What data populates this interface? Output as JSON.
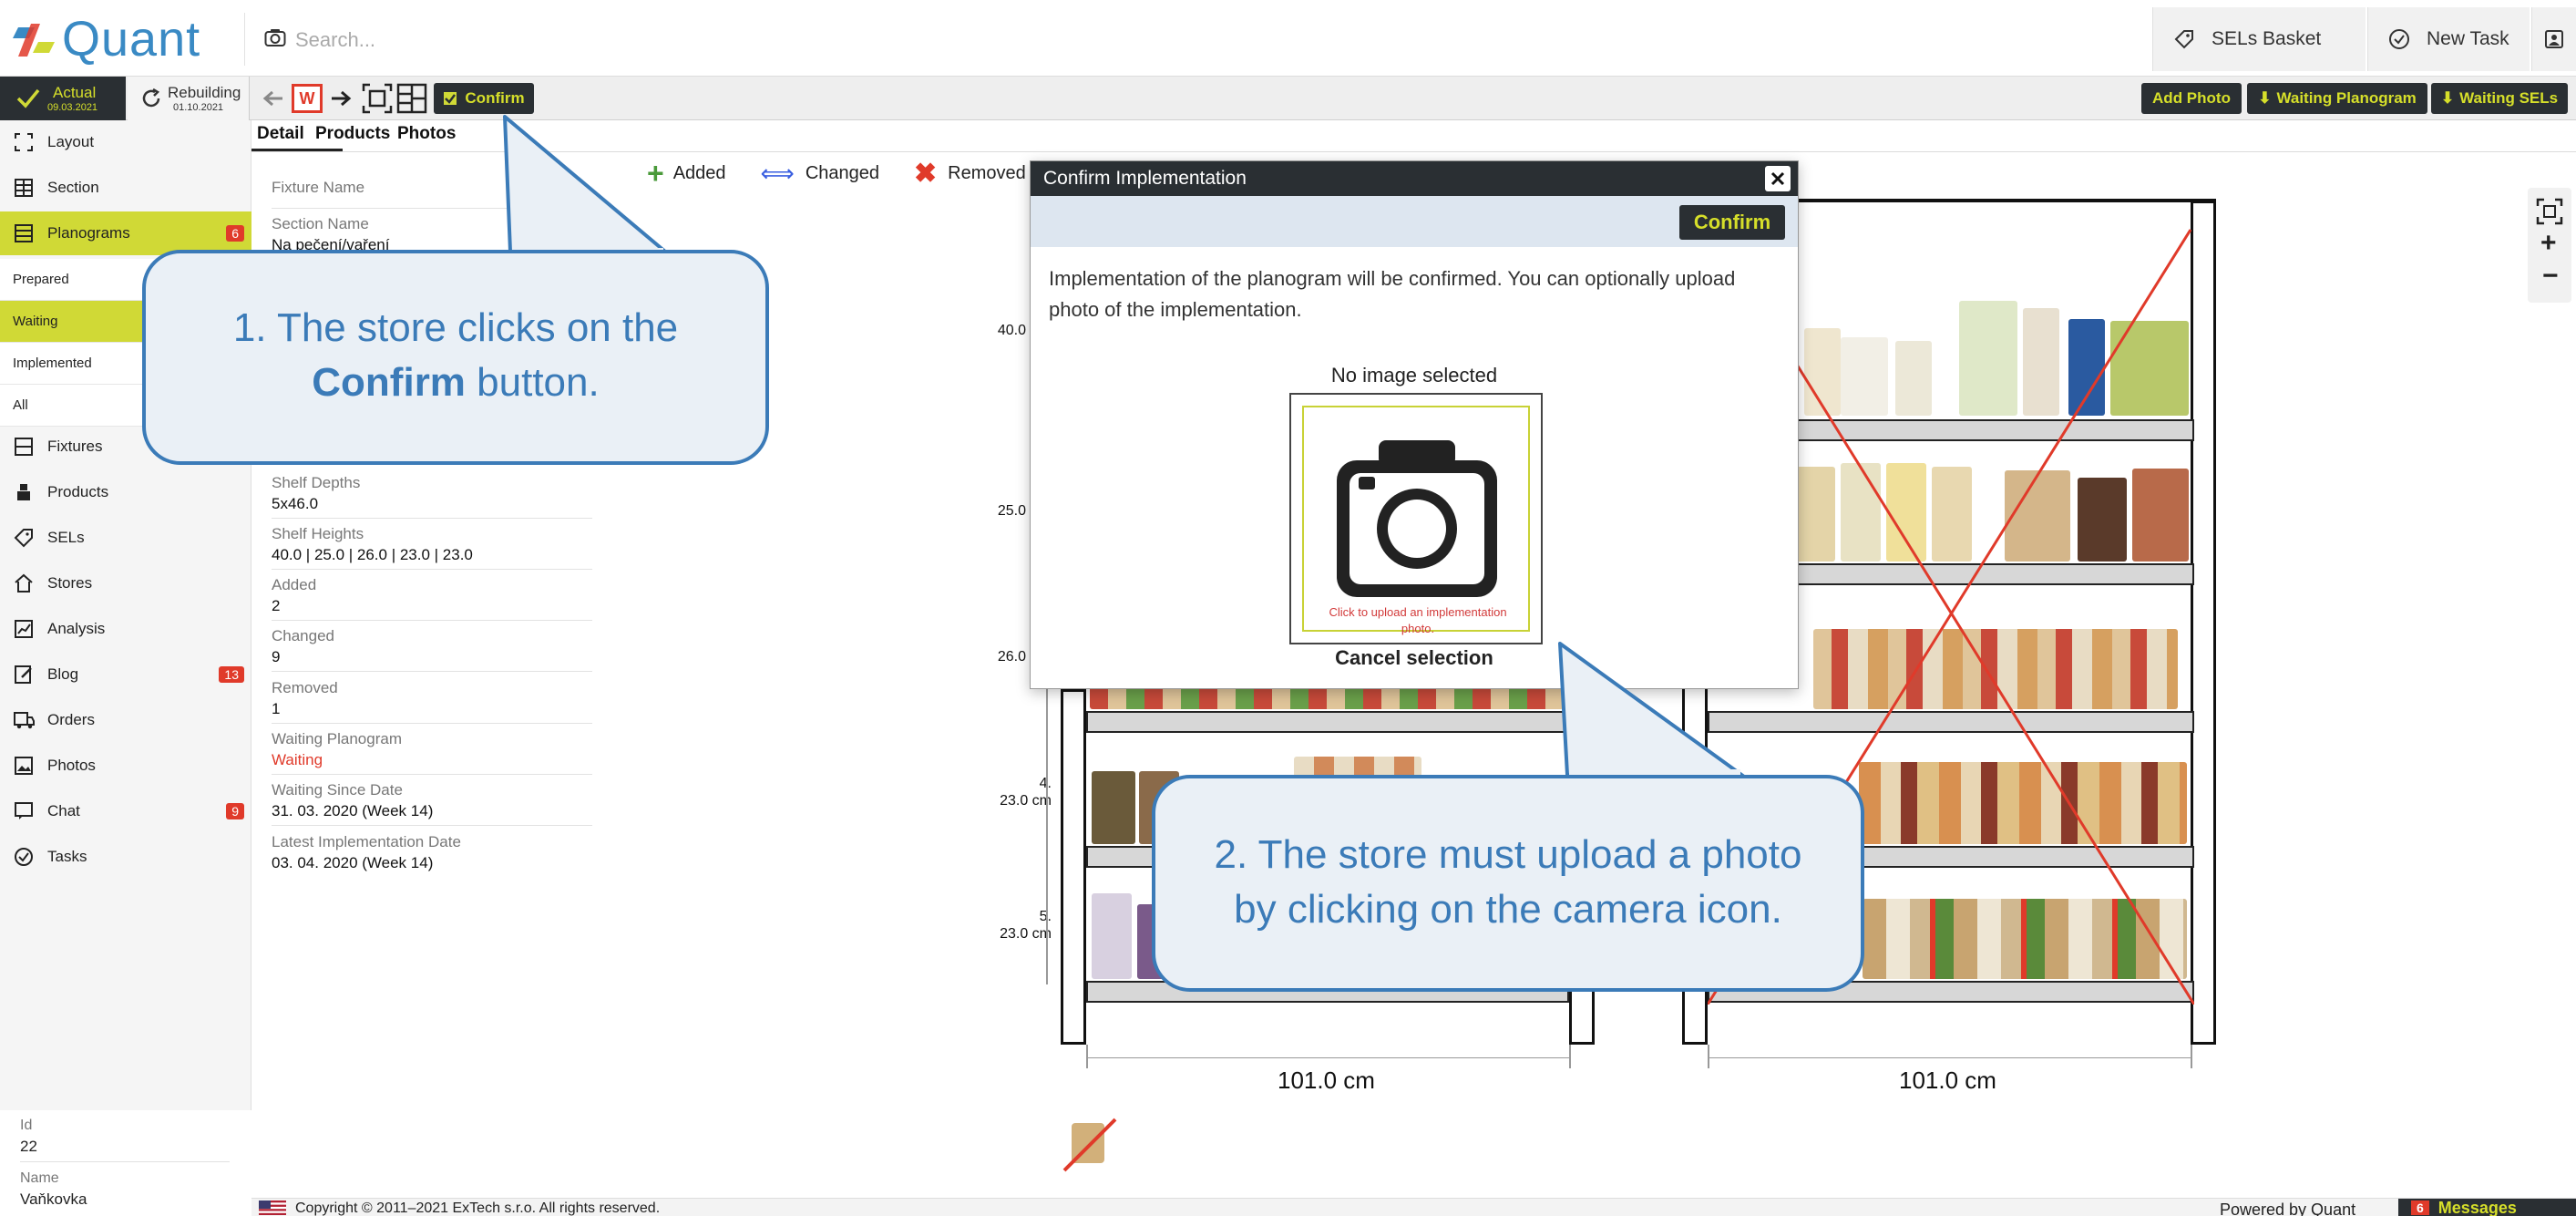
{
  "colors": {
    "accent": "#d0d936",
    "dark": "#2a2f33",
    "brand_blue": "#3a8ac4",
    "callout_blue": "#3b7bb8",
    "badge_red": "#e03a2a"
  },
  "header": {
    "logo_text": "Quant",
    "search_placeholder": "Search...",
    "sels_basket": "SELs Basket",
    "new_task": "New Task"
  },
  "toolbar": {
    "actual_label": "Actual",
    "actual_date": "09.03.2021",
    "rebuilding_label": "Rebuilding",
    "rebuilding_date": "01.10.2021",
    "w_label": "W",
    "confirm_label": "Confirm",
    "add_photo": "Add Photo",
    "waiting_planogram": "Waiting Planogram",
    "waiting_sels": "Waiting SELs"
  },
  "sidebar": {
    "items": [
      {
        "label": "Layout",
        "icon": "layout-icon"
      },
      {
        "label": "Section",
        "icon": "section-icon"
      },
      {
        "label": "Planograms",
        "icon": "planograms-icon",
        "badge": "6"
      },
      {
        "label": "Fixtures",
        "icon": "fixtures-icon"
      },
      {
        "label": "Products",
        "icon": "products-icon"
      },
      {
        "label": "SELs",
        "icon": "tag-icon"
      },
      {
        "label": "Stores",
        "icon": "store-icon"
      },
      {
        "label": "Analysis",
        "icon": "chart-icon"
      },
      {
        "label": "Blog",
        "icon": "blog-icon",
        "badge": "13"
      },
      {
        "label": "Orders",
        "icon": "truck-icon"
      },
      {
        "label": "Photos",
        "icon": "photo-icon"
      },
      {
        "label": "Chat",
        "icon": "chat-icon",
        "badge": "9"
      },
      {
        "label": "Tasks",
        "icon": "task-check-icon"
      }
    ],
    "sub_items": [
      "Prepared",
      "Waiting",
      "Implemented",
      "All"
    ],
    "bottom": {
      "id_label": "Id",
      "id_value": "22",
      "name_label": "Name",
      "name_value": "Vaňkovka"
    }
  },
  "detail": {
    "tabs": [
      "Detail",
      "Products",
      "Photos"
    ],
    "fixture_name_label": "Fixture Name",
    "section_name_label": "Section Name",
    "section_name_value": "Na pečení/vaření",
    "shelf_depths_label": "Shelf Depths",
    "shelf_depths_value": "5x46.0",
    "shelf_heights_label": "Shelf Heights",
    "shelf_heights_value": "40.0 | 25.0 | 26.0 | 23.0 | 23.0",
    "added_label": "Added",
    "added_value": "2",
    "changed_label": "Changed",
    "changed_value": "9",
    "removed_label": "Removed",
    "removed_value": "1",
    "waiting_planogram_label": "Waiting Planogram",
    "waiting_planogram_value": "Waiting",
    "waiting_since_label": "Waiting Since Date",
    "waiting_since_value": "31. 03. 2020 (Week 14)",
    "latest_impl_label": "Latest Implementation Date",
    "latest_impl_value": "03. 04. 2020 (Week 14)"
  },
  "legend": {
    "added": "Added",
    "changed": "Changed",
    "removed": "Removed"
  },
  "planogram": {
    "row_labels": [
      "40.0",
      "25.0",
      "26.0",
      "4.\n23.0 cm",
      "5.\n23.0 cm"
    ],
    "width_left": "101.0 cm",
    "width_right": "101.0 cm"
  },
  "modal": {
    "title": "Confirm Implementation",
    "confirm": "Confirm",
    "text": "Implementation of the planogram will be confirmed. You can optionally upload photo of the implementation.",
    "no_image": "No image selected",
    "upload_hint": "Click to upload an implementation photo.",
    "cancel": "Cancel selection"
  },
  "callouts": {
    "c1_line1": "1. The store clicks on the",
    "c1_bold": "Confirm",
    "c1_rest": " button.",
    "c2_line1": "2. The store must upload a photo",
    "c2_line2": "by clicking on the camera icon."
  },
  "footer": {
    "copyright": "Copyright © 2011–2021 ExTech s.r.o. All rights reserved.",
    "powered": "Powered by Quant",
    "messages_badge": "6",
    "messages": "Messages"
  }
}
